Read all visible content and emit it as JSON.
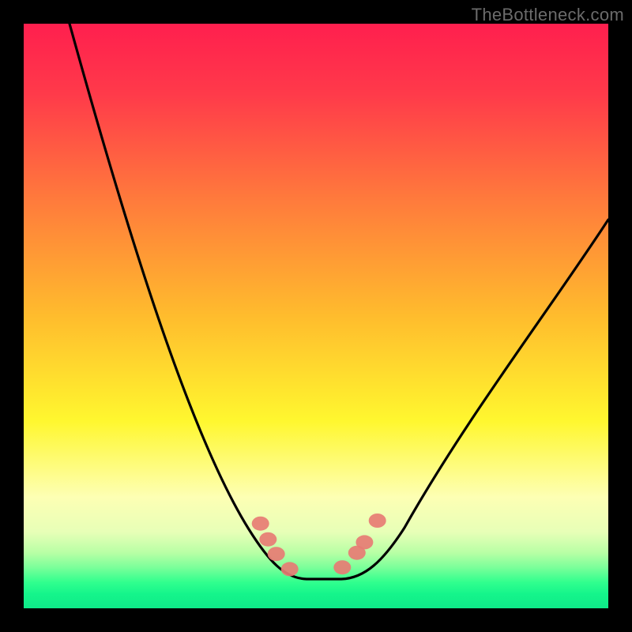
{
  "credit": "TheBottleneck.com",
  "chart_data": {
    "type": "line",
    "title": "",
    "xlabel": "",
    "ylabel": "",
    "xlim": [
      0,
      100
    ],
    "ylim": [
      0,
      100
    ],
    "series": [
      {
        "name": "bottleneck-curve",
        "x_display_range": "≈28%–75% of panel width",
        "y_display_range": "full panel height, minimum near bottom",
        "shape": "asymmetric V / valley",
        "minimum_at_x_fraction": 0.5,
        "left_endpoint_y_fraction": 1.0,
        "right_endpoint_y_fraction": 0.62,
        "flat_bottom_x_fraction_range": [
          0.44,
          0.56
        ]
      }
    ],
    "markers": {
      "name": "highlighted-points",
      "color": "#e77c74",
      "points_x_fraction": [
        0.405,
        0.418,
        0.432,
        0.455,
        0.545,
        0.57,
        0.583,
        0.605
      ],
      "points_y_fraction": [
        0.145,
        0.118,
        0.093,
        0.067,
        0.07,
        0.095,
        0.113,
        0.15
      ]
    },
    "background_gradient_stops": [
      {
        "offset": 0.0,
        "color": "#ff1f4e"
      },
      {
        "offset": 0.12,
        "color": "#ff3a4a"
      },
      {
        "offset": 0.3,
        "color": "#ff7a3c"
      },
      {
        "offset": 0.5,
        "color": "#ffbc2d"
      },
      {
        "offset": 0.68,
        "color": "#fff72f"
      },
      {
        "offset": 0.81,
        "color": "#fdffb4"
      },
      {
        "offset": 0.87,
        "color": "#e7ffb7"
      },
      {
        "offset": 0.905,
        "color": "#b8ffa5"
      },
      {
        "offset": 0.93,
        "color": "#7bff9a"
      },
      {
        "offset": 0.955,
        "color": "#32ff8e"
      },
      {
        "offset": 0.975,
        "color": "#15f58b"
      },
      {
        "offset": 1.0,
        "color": "#0eea89"
      }
    ]
  }
}
